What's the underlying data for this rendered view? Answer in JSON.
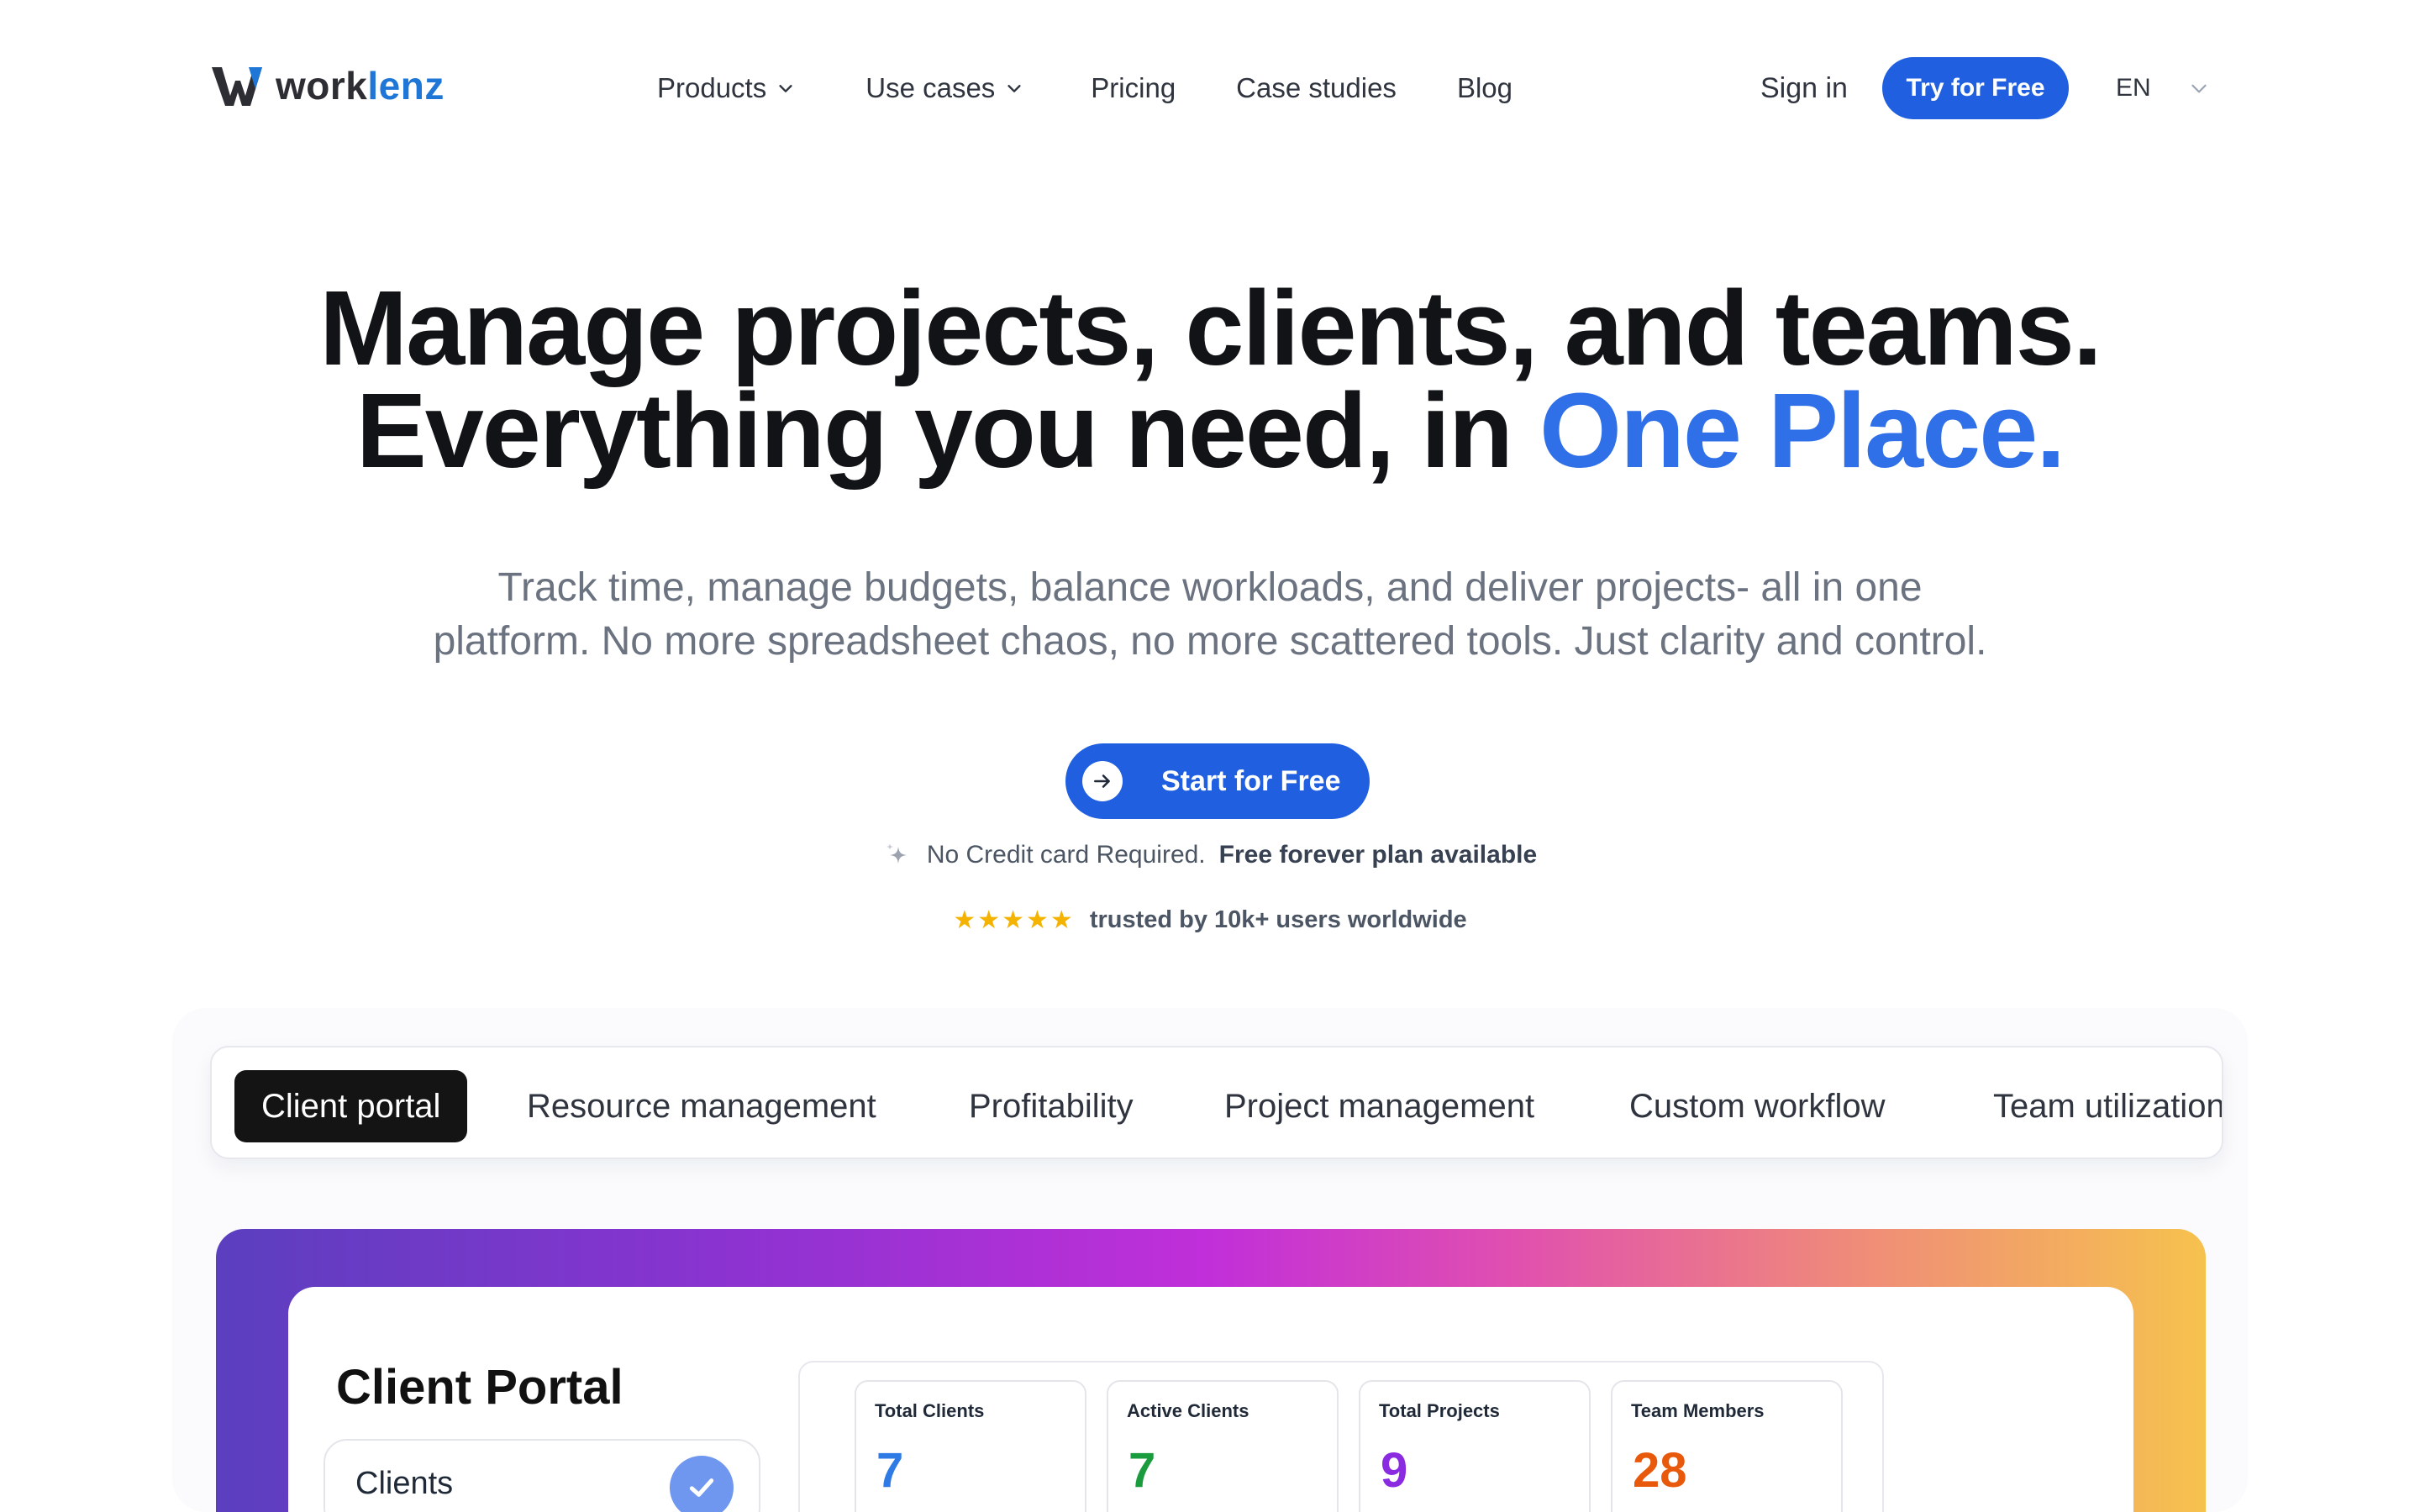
{
  "brand": {
    "name_part1": "work",
    "name_part2": "lenz"
  },
  "nav": {
    "products": "Products",
    "use_cases": "Use cases",
    "pricing": "Pricing",
    "case_studies": "Case studies",
    "blog": "Blog"
  },
  "header": {
    "sign_in": "Sign in",
    "try_free": "Try for Free",
    "language": "EN"
  },
  "hero": {
    "title_line1": "Manage projects, clients, and teams.",
    "title_line2_prefix": "Everything you need, in ",
    "title_line2_highlight": "One Place.",
    "subtitle_line1": "Track time, manage budgets, balance workloads, and deliver projects- all in one",
    "subtitle_line2": "platform. No more spreadsheet chaos, no more scattered tools. Just clarity and control.",
    "cta": "Start for Free",
    "no_cc": "No Credit card Required.",
    "free_plan": "Free forever plan available",
    "stars": "★★★★★",
    "trusted": "trusted by 10k+ users worldwide"
  },
  "tabs": [
    {
      "label": "Client portal",
      "active": true
    },
    {
      "label": "Resource management",
      "active": false
    },
    {
      "label": "Profitability",
      "active": false
    },
    {
      "label": "Project management",
      "active": false
    },
    {
      "label": "Custom workflow",
      "active": false
    },
    {
      "label": "Team utilization",
      "active": false
    }
  ],
  "preview": {
    "title": "Client Portal",
    "clients_item": "Clients",
    "stats": [
      {
        "label": "Total Clients",
        "value": "7",
        "color": "#2f7be6"
      },
      {
        "label": "Active Clients",
        "value": "7",
        "color": "#1a9c3e"
      },
      {
        "label": "Total Projects",
        "value": "9",
        "color": "#8a2be2"
      },
      {
        "label": "Team Members",
        "value": "28",
        "color": "#e8590c"
      }
    ]
  },
  "colors": {
    "primary": "#1f5fe0",
    "highlight": "#2f6fe8",
    "brand_accent": "#1e76d6"
  }
}
